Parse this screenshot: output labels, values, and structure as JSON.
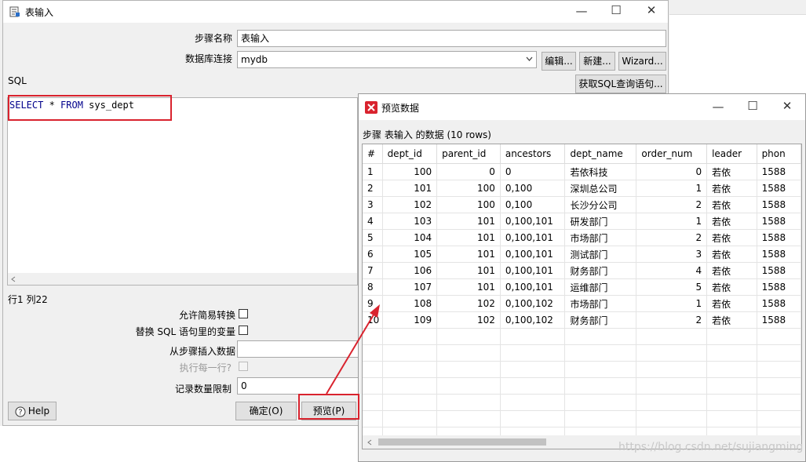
{
  "main_dialog": {
    "title": "表输入",
    "win_controls": {
      "minimize": "—",
      "maximize": "☐",
      "close": "✕"
    },
    "step_name_label": "步骤名称",
    "step_name_value": "表输入",
    "db_conn_label": "数据库连接",
    "db_conn_value": "mydb",
    "edit_button": "编辑...",
    "new_button": "新建...",
    "wizard_button": "Wizard...",
    "sql_label": "SQL",
    "get_sql_button": "获取SQL查询语句...",
    "sql": {
      "kw1": "SELECT",
      "mid": " * ",
      "kw2": "FROM",
      "rest": " sys_dept"
    },
    "cursor_position": "行1 列22",
    "lazy_conversion_label": "允许简易转换",
    "replace_variables_label": "替换 SQL 语句里的变量",
    "insert_from_step_label": "从步骤插入数据",
    "execute_each_row_label": "执行每一行?",
    "limit_label": "记录数量限制",
    "limit_value": "0",
    "help_button": "Help",
    "ok_button": "确定(O)",
    "preview_button": "预览(P)"
  },
  "preview_dialog": {
    "title": "预览数据",
    "win_controls": {
      "minimize": "—",
      "maximize": "☐",
      "close": "✕"
    },
    "subtitle": "步骤 表输入 的数据  (10 rows)",
    "columns": [
      "#",
      "dept_id",
      "parent_id",
      "ancestors",
      "dept_name",
      "order_num",
      "leader",
      "phon"
    ],
    "rows": [
      [
        "1",
        "100",
        "0",
        "0",
        "若依科技",
        "0",
        "若依",
        "1588"
      ],
      [
        "2",
        "101",
        "100",
        "0,100",
        "深圳总公司",
        "1",
        "若依",
        "1588"
      ],
      [
        "3",
        "102",
        "100",
        "0,100",
        "长沙分公司",
        "2",
        "若依",
        "1588"
      ],
      [
        "4",
        "103",
        "101",
        "0,100,101",
        "研发部门",
        "1",
        "若依",
        "1588"
      ],
      [
        "5",
        "104",
        "101",
        "0,100,101",
        "市场部门",
        "2",
        "若依",
        "1588"
      ],
      [
        "6",
        "105",
        "101",
        "0,100,101",
        "测试部门",
        "3",
        "若依",
        "1588"
      ],
      [
        "7",
        "106",
        "101",
        "0,100,101",
        "财务部门",
        "4",
        "若依",
        "1588"
      ],
      [
        "8",
        "107",
        "101",
        "0,100,101",
        "运维部门",
        "5",
        "若依",
        "1588"
      ],
      [
        "9",
        "108",
        "102",
        "0,100,102",
        "市场部门",
        "1",
        "若依",
        "1588"
      ],
      [
        "10",
        "109",
        "102",
        "0,100,102",
        "财务部门",
        "2",
        "若依",
        "1588"
      ]
    ]
  },
  "watermark": "https://blog.csdn.net/sujiangming",
  "colors": {
    "highlight": "#d9232e",
    "sql_keyword": "#00008b"
  }
}
